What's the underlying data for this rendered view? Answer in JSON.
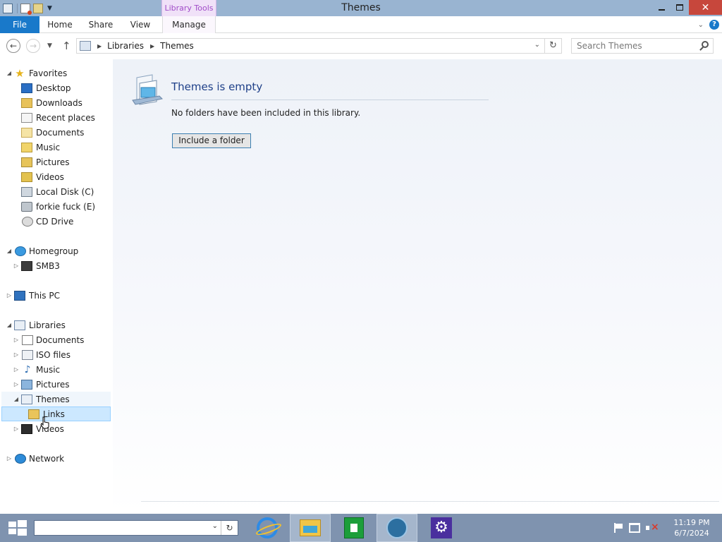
{
  "window": {
    "title": "Themes",
    "contextual_tab_group": "Library Tools",
    "close_glyph": "✕"
  },
  "ribbon": {
    "tabs": [
      {
        "label": "File"
      },
      {
        "label": "Home"
      },
      {
        "label": "Share"
      },
      {
        "label": "View"
      },
      {
        "label": "Manage"
      }
    ],
    "help_glyph": "?"
  },
  "address_bar": {
    "breadcrumbs": [
      "Libraries",
      "Themes"
    ],
    "search_placeholder": "Search Themes"
  },
  "nav_pane": {
    "favorites": {
      "label": "Favorites",
      "items": [
        "Desktop",
        "Downloads",
        "Recent places",
        "Documents",
        "Music",
        "Pictures",
        "Videos",
        "Local Disk (C)",
        "forkie fuck (E)",
        "CD Drive"
      ]
    },
    "homegroup": {
      "label": "Homegroup",
      "items": [
        "SMB3"
      ]
    },
    "this_pc": {
      "label": "This PC"
    },
    "libraries": {
      "label": "Libraries",
      "items": [
        "Documents",
        "ISO files",
        "Music",
        "Pictures",
        "Themes",
        "Links",
        "Videos"
      ]
    },
    "network": {
      "label": "Network"
    }
  },
  "content": {
    "empty_title": "Themes is empty",
    "empty_message": "No folders have been included in this library.",
    "include_button": "Include a folder"
  },
  "taskbar": {
    "clock_time": "11:19 PM",
    "clock_date": "6/7/2024"
  },
  "colors": {
    "file_tab": "#1979ca",
    "title_bar": "#99b4d1",
    "close_button": "#c7473c",
    "contextual_tab": "#a04cc8",
    "empty_title": "#1e3f88",
    "taskbar": "#7f93af",
    "selection": "#cce8ff"
  }
}
